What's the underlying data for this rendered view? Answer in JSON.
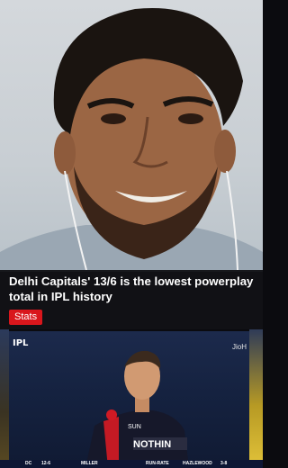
{
  "card": {
    "headline": "Delhi Capitals' 13/6 is the lowest powerplay total in IPL history",
    "chip": "Stats"
  },
  "broadcast": {
    "logo": "IPL",
    "channel": "JioH",
    "ticker": {
      "team": "DC",
      "score": "12-6",
      "batter": "MILLER",
      "run_rate_label": "RUN-RATE",
      "bowler": "HAZLEWOOD",
      "bowler_figs": "3-8"
    }
  },
  "colors": {
    "chip": "#d9161c",
    "card_bg": "#121216",
    "broadcast_bg": "#152240"
  }
}
